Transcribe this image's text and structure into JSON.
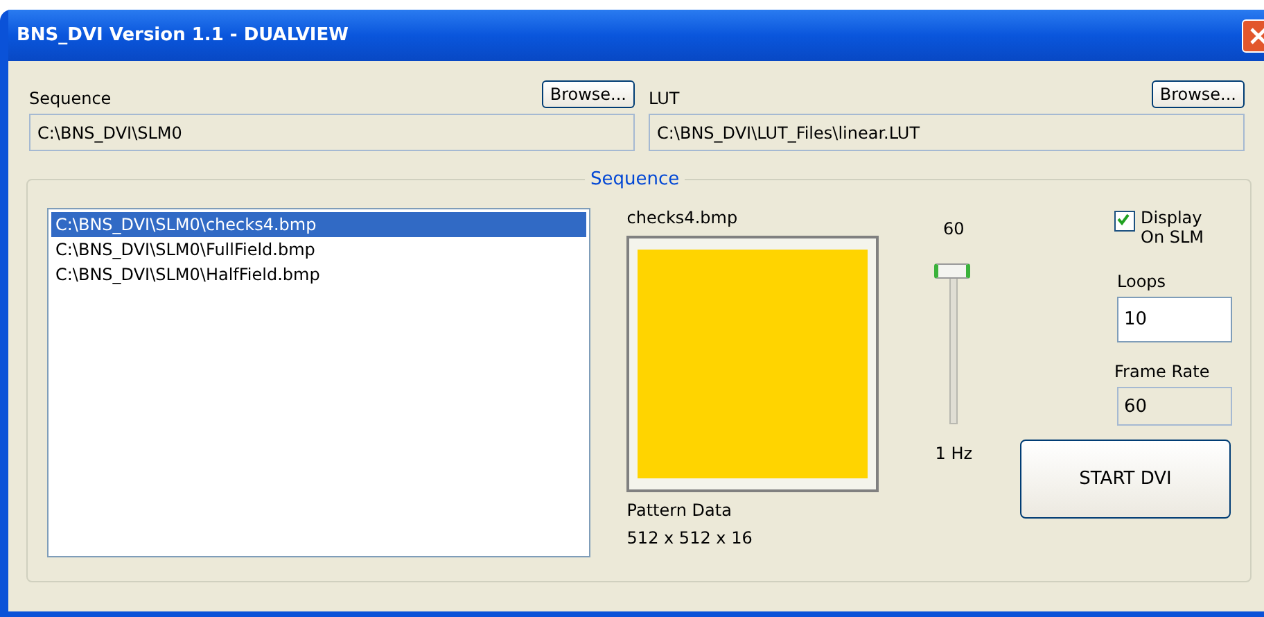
{
  "window": {
    "title": "BNS_DVI Version 1.1 - DUALVIEW"
  },
  "sequence": {
    "label": "Sequence",
    "browse": "Browse...",
    "path": "C:\\BNS_DVI\\SLM0"
  },
  "lut": {
    "label": "LUT",
    "browse": "Browse...",
    "path": "C:\\BNS_DVI\\LUT_Files\\linear.LUT"
  },
  "group": {
    "title": "Sequence",
    "files": [
      {
        "name": "C:\\BNS_DVI\\SLM0\\checks4.bmp",
        "selected": true
      },
      {
        "name": "C:\\BNS_DVI\\SLM0\\FullField.bmp",
        "selected": false
      },
      {
        "name": "C:\\BNS_DVI\\SLM0\\HalfField.bmp",
        "selected": false
      }
    ],
    "preview_name": "checks4.bmp",
    "pattern_label": "Pattern Data",
    "pattern_size": "512 x 512 x 16",
    "slider": {
      "max_label": "60",
      "min_label": "1 Hz",
      "level": 1
    },
    "display_on_slm": {
      "label": "Display On SLM",
      "checked": true
    },
    "loops": {
      "label": "Loops",
      "value": "10"
    },
    "frame_rate": {
      "label": "Frame Rate",
      "value": "60"
    },
    "start_button": "START DVI"
  }
}
